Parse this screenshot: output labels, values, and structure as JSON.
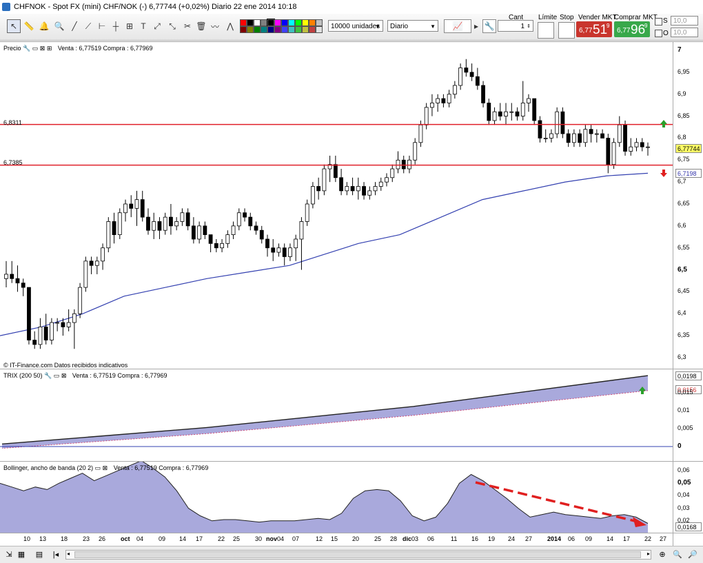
{
  "window": {
    "title": "CHFNOK - Spot FX (mini) CHF/NOK (-)   6,77744 (+0,02%)   Diario  22 ene 2014 10:18"
  },
  "toolbar": {
    "units_select": "10000 unidades",
    "period_select": "Diario",
    "cant_label": "Cant",
    "cant_value": "1",
    "limite_label": "Límite",
    "stop_label": "Stop",
    "vender_label": "Vender MKT",
    "comprar_label": "Comprar MKT",
    "sell_small": "6,77",
    "sell_big": "51",
    "sell_sup": "9",
    "buy_small": "6,77",
    "buy_big": "96",
    "buy_sup": "9",
    "s_label": "S",
    "o_label": "O",
    "s_value": "10,0",
    "o_value": "10,0",
    "colors": [
      "#ff0000",
      "#000000",
      "#ffffff",
      "#808080",
      "#c0c0c0",
      "#ff00ff",
      "#0000ff",
      "#00ffff",
      "#00ff00",
      "#ffff00",
      "#800000",
      "#808000",
      "#008000",
      "#008080",
      "#000080",
      "#800080"
    ]
  },
  "price_panel": {
    "label": "Precio",
    "quote": "Venta : 6,77519  Compra : 6,77969",
    "source": "© IT-Finance.com  Datos recibidos indicativos",
    "line1_label": "6,8311",
    "line2_label": "6,7385",
    "last_price": "6,77744",
    "ma_value": "6,7198",
    "yticks": [
      "7",
      "6,95",
      "6,9",
      "6,85",
      "6,8",
      "6,75",
      "6,7",
      "6,65",
      "6,6",
      "6,55",
      "6,5",
      "6,45",
      "6,4",
      "6,35",
      "6,3"
    ]
  },
  "trix_panel": {
    "label": "TRIX (200 50)",
    "quote": "Venta : 6,77519  Compra : 6,77969",
    "value1": "0,0198",
    "value2": "0,0156",
    "yticks": [
      "0,015",
      "0,01",
      "0,005",
      "0"
    ]
  },
  "boll_panel": {
    "label": "Bollinger, ancho de banda (20 2)",
    "quote": "Venta : 6,77519  Compra : 6,77969",
    "value": "0,0168",
    "yticks": [
      "0,06",
      "0,05",
      "0,04",
      "0,03",
      "0,02"
    ]
  },
  "xaxis": {
    "ticks": [
      "10",
      "13",
      "18",
      "23",
      "26",
      "oct",
      "04",
      "09",
      "14",
      "17",
      "22",
      "25",
      "30",
      "nov",
      "04",
      "07",
      "12",
      "15",
      "20",
      "25",
      "28",
      "dic",
      "03",
      "06",
      "11",
      "16",
      "19",
      "24",
      "27",
      "2014",
      "06",
      "09",
      "14",
      "17",
      "22",
      "27"
    ]
  },
  "chart_data": {
    "type": "candlestick",
    "title": "CHFNOK - Spot FX (mini) CHF/NOK (-)",
    "ylim": [
      6.28,
      7.01
    ],
    "horizontal_lines": [
      6.8311,
      6.7385
    ],
    "candles": [
      [
        6.48,
        6.52,
        6.46,
        6.49
      ],
      [
        6.49,
        6.52,
        6.47,
        6.48
      ],
      [
        6.48,
        6.51,
        6.45,
        6.47
      ],
      [
        6.47,
        6.48,
        6.44,
        6.46
      ],
      [
        6.46,
        6.46,
        6.33,
        6.34
      ],
      [
        6.34,
        6.36,
        6.32,
        6.33
      ],
      [
        6.33,
        6.39,
        6.32,
        6.37
      ],
      [
        6.37,
        6.4,
        6.33,
        6.34
      ],
      [
        6.34,
        6.39,
        6.33,
        6.38
      ],
      [
        6.38,
        6.39,
        6.36,
        6.38
      ],
      [
        6.38,
        6.39,
        6.35,
        6.37
      ],
      [
        6.37,
        6.41,
        6.36,
        6.38
      ],
      [
        6.38,
        6.41,
        6.32,
        6.4
      ],
      [
        6.4,
        6.47,
        6.39,
        6.46
      ],
      [
        6.46,
        6.53,
        6.45,
        6.52
      ],
      [
        6.52,
        6.53,
        6.49,
        6.51
      ],
      [
        6.51,
        6.53,
        6.49,
        6.52
      ],
      [
        6.52,
        6.56,
        6.5,
        6.55
      ],
      [
        6.55,
        6.62,
        6.54,
        6.61
      ],
      [
        6.61,
        6.63,
        6.56,
        6.58
      ],
      [
        6.58,
        6.64,
        6.57,
        6.63
      ],
      [
        6.63,
        6.66,
        6.61,
        6.65
      ],
      [
        6.65,
        6.67,
        6.62,
        6.64
      ],
      [
        6.64,
        6.68,
        6.6,
        6.66
      ],
      [
        6.66,
        6.68,
        6.61,
        6.62
      ],
      [
        6.62,
        6.64,
        6.58,
        6.59
      ],
      [
        6.59,
        6.63,
        6.57,
        6.61
      ],
      [
        6.61,
        6.62,
        6.57,
        6.59
      ],
      [
        6.59,
        6.63,
        6.58,
        6.62
      ],
      [
        6.62,
        6.65,
        6.58,
        6.6
      ],
      [
        6.6,
        6.62,
        6.59,
        6.61
      ],
      [
        6.61,
        6.64,
        6.6,
        6.63
      ],
      [
        6.63,
        6.64,
        6.59,
        6.6
      ],
      [
        6.6,
        6.62,
        6.56,
        6.57
      ],
      [
        6.57,
        6.61,
        6.56,
        6.6
      ],
      [
        6.6,
        6.61,
        6.57,
        6.58
      ],
      [
        6.58,
        6.58,
        6.54,
        6.56
      ],
      [
        6.56,
        6.57,
        6.54,
        6.55
      ],
      [
        6.55,
        6.57,
        6.54,
        6.56
      ],
      [
        6.56,
        6.59,
        6.55,
        6.58
      ],
      [
        6.58,
        6.61,
        6.57,
        6.6
      ],
      [
        6.6,
        6.64,
        6.59,
        6.63
      ],
      [
        6.63,
        6.64,
        6.61,
        6.62
      ],
      [
        6.62,
        6.63,
        6.59,
        6.6
      ],
      [
        6.6,
        6.61,
        6.58,
        6.59
      ],
      [
        6.59,
        6.6,
        6.56,
        6.57
      ],
      [
        6.57,
        6.58,
        6.53,
        6.55
      ],
      [
        6.55,
        6.57,
        6.52,
        6.54
      ],
      [
        6.54,
        6.56,
        6.53,
        6.55
      ],
      [
        6.55,
        6.56,
        6.51,
        6.53
      ],
      [
        6.53,
        6.56,
        6.52,
        6.55
      ],
      [
        6.55,
        6.58,
        6.52,
        6.57
      ],
      [
        6.57,
        6.62,
        6.5,
        6.61
      ],
      [
        6.61,
        6.66,
        6.6,
        6.65
      ],
      [
        6.65,
        6.7,
        6.64,
        6.69
      ],
      [
        6.69,
        6.71,
        6.66,
        6.68
      ],
      [
        6.68,
        6.74,
        6.67,
        6.73
      ],
      [
        6.73,
        6.76,
        6.7,
        6.74
      ],
      [
        6.74,
        6.76,
        6.7,
        6.71
      ],
      [
        6.71,
        6.73,
        6.67,
        6.68
      ],
      [
        6.68,
        6.7,
        6.67,
        6.69
      ],
      [
        6.69,
        6.71,
        6.67,
        6.68
      ],
      [
        6.68,
        6.71,
        6.66,
        6.69
      ],
      [
        6.69,
        6.7,
        6.66,
        6.67
      ],
      [
        6.67,
        6.69,
        6.66,
        6.68
      ],
      [
        6.68,
        6.7,
        6.67,
        6.69
      ],
      [
        6.69,
        6.71,
        6.68,
        6.7
      ],
      [
        6.7,
        6.72,
        6.69,
        6.71
      ],
      [
        6.71,
        6.74,
        6.7,
        6.73
      ],
      [
        6.73,
        6.77,
        6.72,
        6.75
      ],
      [
        6.75,
        6.76,
        6.72,
        6.73
      ],
      [
        6.73,
        6.76,
        6.72,
        6.75
      ],
      [
        6.75,
        6.8,
        6.74,
        6.79
      ],
      [
        6.79,
        6.84,
        6.78,
        6.83
      ],
      [
        6.83,
        6.88,
        6.82,
        6.87
      ],
      [
        6.87,
        6.9,
        6.85,
        6.88
      ],
      [
        6.88,
        6.9,
        6.86,
        6.89
      ],
      [
        6.89,
        6.9,
        6.87,
        6.88
      ],
      [
        6.88,
        6.91,
        6.87,
        6.9
      ],
      [
        6.9,
        6.93,
        6.89,
        6.92
      ],
      [
        6.92,
        6.97,
        6.91,
        6.96
      ],
      [
        6.96,
        6.98,
        6.94,
        6.95
      ],
      [
        6.95,
        6.97,
        6.93,
        6.94
      ],
      [
        6.94,
        6.96,
        6.91,
        6.92
      ],
      [
        6.92,
        6.93,
        6.87,
        6.88
      ],
      [
        6.88,
        6.89,
        6.83,
        6.84
      ],
      [
        6.84,
        6.87,
        6.83,
        6.86
      ],
      [
        6.86,
        6.88,
        6.84,
        6.85
      ],
      [
        6.85,
        6.88,
        6.83,
        6.86
      ],
      [
        6.86,
        6.88,
        6.84,
        6.86
      ],
      [
        6.86,
        6.87,
        6.84,
        6.85
      ],
      [
        6.85,
        6.93,
        6.84,
        6.88
      ],
      [
        6.88,
        6.9,
        6.86,
        6.89
      ],
      [
        6.89,
        6.89,
        6.83,
        6.84
      ],
      [
        6.84,
        6.85,
        6.79,
        6.8
      ],
      [
        6.8,
        6.82,
        6.79,
        6.8
      ],
      [
        6.8,
        6.82,
        6.79,
        6.81
      ],
      [
        6.81,
        6.87,
        6.8,
        6.86
      ],
      [
        6.86,
        6.87,
        6.8,
        6.81
      ],
      [
        6.81,
        6.82,
        6.78,
        6.79
      ],
      [
        6.79,
        6.82,
        6.78,
        6.81
      ],
      [
        6.81,
        6.82,
        6.78,
        6.79
      ],
      [
        6.79,
        6.83,
        6.78,
        6.82
      ],
      [
        6.82,
        6.83,
        6.79,
        6.81
      ],
      [
        6.81,
        6.82,
        6.79,
        6.81
      ],
      [
        6.81,
        6.82,
        6.8,
        6.8
      ],
      [
        6.8,
        6.81,
        6.72,
        6.74
      ],
      [
        6.74,
        6.8,
        6.73,
        6.79
      ],
      [
        6.79,
        6.85,
        6.78,
        6.83
      ],
      [
        6.83,
        6.84,
        6.76,
        6.77
      ],
      [
        6.77,
        6.8,
        6.76,
        6.78
      ],
      [
        6.78,
        6.8,
        6.77,
        6.79
      ],
      [
        6.79,
        6.8,
        6.77,
        6.78
      ],
      [
        6.78,
        6.79,
        6.76,
        6.78
      ]
    ],
    "moving_average": [
      [
        0,
        6.35
      ],
      [
        60,
        6.37
      ],
      [
        120,
        6.4
      ],
      [
        180,
        6.44
      ],
      [
        240,
        6.46
      ],
      [
        300,
        6.48
      ],
      [
        360,
        6.495
      ],
      [
        420,
        6.51
      ],
      [
        460,
        6.53
      ],
      [
        520,
        6.56
      ],
      [
        580,
        6.58
      ],
      [
        640,
        6.62
      ],
      [
        700,
        6.66
      ],
      [
        760,
        6.68
      ],
      [
        820,
        6.7
      ],
      [
        880,
        6.714
      ],
      [
        940,
        6.72
      ]
    ],
    "trix": {
      "signal_end": 0.0156,
      "trix_end": 0.0198
    },
    "bollinger_width": [
      0.05,
      0.047,
      0.044,
      0.047,
      0.045,
      0.05,
      0.054,
      0.058,
      0.052,
      0.056,
      0.06,
      0.064,
      0.068,
      0.062,
      0.055,
      0.044,
      0.03,
      0.024,
      0.02,
      0.021,
      0.021,
      0.02,
      0.019,
      0.02,
      0.02,
      0.02,
      0.021,
      0.022,
      0.021,
      0.026,
      0.038,
      0.044,
      0.045,
      0.044,
      0.036,
      0.024,
      0.02,
      0.023,
      0.034,
      0.05,
      0.057,
      0.052,
      0.045,
      0.038,
      0.03,
      0.023,
      0.025,
      0.027,
      0.025,
      0.024,
      0.023,
      0.022,
      0.024,
      0.025,
      0.023,
      0.018
    ]
  }
}
